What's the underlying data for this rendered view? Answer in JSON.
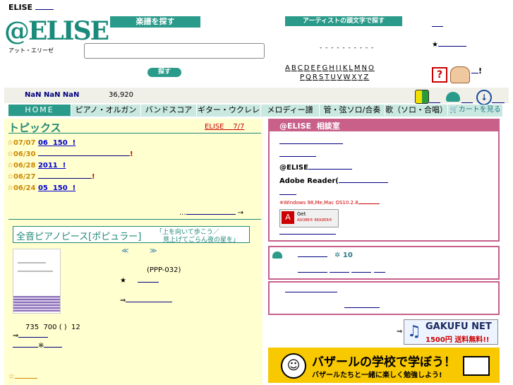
{
  "header": {
    "top_label": "ELISE",
    "logo_text": "@ELISE",
    "logo_sub": "アット・エリーゼ",
    "search_title": "楽譜を探す",
    "search_button": "探す",
    "artist_title": "アーティストの頭文字で探す",
    "artist_dashes": "- - - - -  - - - - -",
    "alpha_row1": [
      "A",
      "B",
      "C",
      "D",
      "E",
      "F",
      "G",
      "H",
      "I",
      "J",
      "K",
      "L",
      "M",
      "N",
      "O"
    ],
    "alpha_row2": [
      "P",
      "Q",
      "R",
      "S",
      "T",
      "U",
      "V",
      "W",
      "X",
      "Y",
      "Z"
    ],
    "star": "★",
    "help_icon": "?",
    "exclaim": "!"
  },
  "status": {
    "nan_text": "NaN NaN NaN",
    "count": "36,920"
  },
  "nav": {
    "tabs": [
      "HOME",
      "ピアノ・オルガン",
      "バンドスコア",
      "ギター・ウクレレ",
      "メロディー譜",
      "管・弦ソロ/合奏",
      "歌（ソロ・合唱）"
    ],
    "cart_label": "カートを見る"
  },
  "topics": {
    "title": "トピックス",
    "elise_link": "ELISE",
    "elise_date": "7/7",
    "items": [
      {
        "date": "☆07/07",
        "text": "06  150  !"
      },
      {
        "date": "☆06/30",
        "text": "!"
      },
      {
        "date": "☆06/28",
        "text": "2011  !"
      },
      {
        "date": "☆06/27",
        "text": "!"
      },
      {
        "date": "☆06/24",
        "text": "05  150  !"
      }
    ],
    "more": "...",
    "arrow": "→"
  },
  "feature": {
    "title_main": "全音ピアノピース[ポピュラー]",
    "title_sub1": "「上を向いて歩こう／",
    "title_sub2": "見上げてごらん夜の星を」",
    "nav_prev": "≪",
    "nav_next": "≫",
    "code": "(PPP-032)",
    "star": "★",
    "arrow": "⇒",
    "price_line": "735  700 ( )  12",
    "arrow2": "⇒",
    "small_mark": "※",
    "bottom_star": "☆"
  },
  "consult": {
    "title": "@ELISE  相談室",
    "label1": "@ELISE",
    "label2": "Adobe Reader(",
    "note": "※Windows 98,Me,Mac OS10.2.8",
    "adobe_get": "Get",
    "adobe_reader": "ADOBE® READER®"
  },
  "box2": {
    "count": "10"
  },
  "banners": {
    "arrow": "⇒",
    "gakufu_title": "GAKUFU NET",
    "gakufu_sub": "1500円 送料無料!!",
    "bazaar_title": "バザールの学校で学ぼう！",
    "bazaar_sub": "バザールたちと一緒に楽しく勉強しよう!"
  }
}
